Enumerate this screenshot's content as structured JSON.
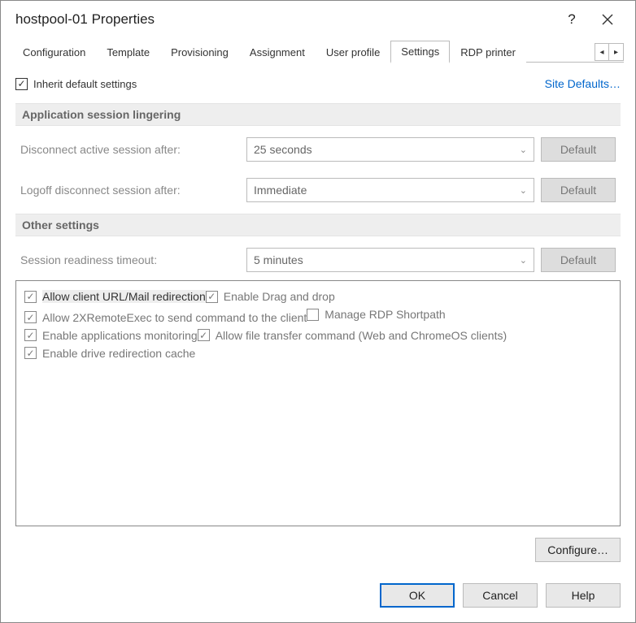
{
  "title": "hostpool-01 Properties",
  "tabs": [
    "Configuration",
    "Template",
    "Provisioning",
    "Assignment",
    "User profile",
    "Settings",
    "RDP printer"
  ],
  "activeTab": "Settings",
  "inherit": {
    "checked": true,
    "label": "Inherit default settings"
  },
  "siteDefaults": "Site Defaults…",
  "sections": {
    "lingering": {
      "header": "Application session lingering",
      "rows": [
        {
          "label": "Disconnect active session after:",
          "value": "25 seconds",
          "default": "Default"
        },
        {
          "label": "Logoff disconnect session after:",
          "value": "Immediate",
          "default": "Default"
        }
      ]
    },
    "other": {
      "header": "Other settings",
      "rows": [
        {
          "label": "Session readiness timeout:",
          "value": "5 minutes",
          "default": "Default"
        }
      ]
    }
  },
  "options": [
    {
      "checked": true,
      "selected": true,
      "label": "Allow client URL/Mail redirection"
    },
    {
      "checked": true,
      "selected": false,
      "label": "Enable Drag and drop"
    },
    {
      "checked": true,
      "selected": false,
      "label": "Allow 2XRemoteExec to send command to the client"
    },
    {
      "checked": false,
      "selected": false,
      "label": "Manage RDP Shortpath"
    },
    {
      "checked": true,
      "selected": false,
      "label": "Enable applications monitoring"
    },
    {
      "checked": true,
      "selected": false,
      "label": "Allow file transfer command (Web and ChromeOS clients)"
    },
    {
      "checked": true,
      "selected": false,
      "label": "Enable drive redirection cache"
    }
  ],
  "configureLabel": "Configure…",
  "buttons": {
    "ok": "OK",
    "cancel": "Cancel",
    "help": "Help"
  }
}
